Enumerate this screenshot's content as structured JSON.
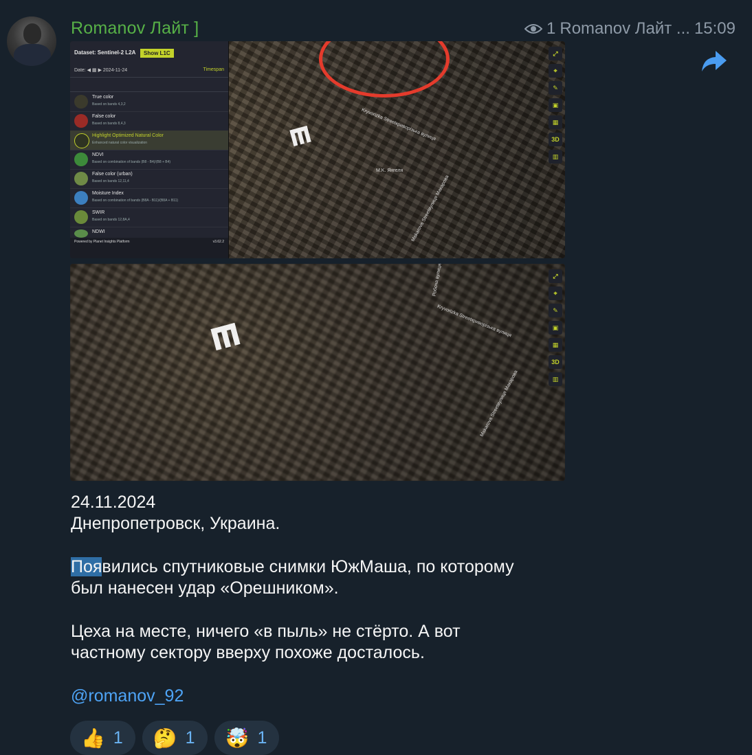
{
  "message": {
    "sender": "Romanov Лайт ]",
    "views": "1",
    "views_author": "Romanov Лайт ...",
    "time": "15:09",
    "text": {
      "date": "24.11.2024",
      "location": "Днепропетровск, Украина.",
      "p2_highlight": "Поя",
      "p2_rest_line1": "вились спутниковые снимки ЮжМаша, по которому",
      "p2_line2": "был нанесен удар «Орешником».",
      "p3_line1": "Цеха на месте, ничего «в пыль» не стёрто. А вот",
      "p3_line2": "частному сектору вверху похоже досталось.",
      "link": "@romanov_92"
    },
    "reactions": [
      {
        "emoji": "👍",
        "count": "1"
      },
      {
        "emoji": "🤔",
        "count": "1"
      },
      {
        "emoji": "🤯",
        "count": "1"
      }
    ]
  },
  "screenshot1": {
    "dataset": "Dataset: Sentinel-2 L2A",
    "show_l1c": "Show L1C",
    "date": "Date: ◀ ▦ ▶ 2024-11-24",
    "timespan": "Timespan",
    "layers": [
      {
        "name": "True color",
        "desc": "Based on bands 4,3,2",
        "color": "#3b3a2c"
      },
      {
        "name": "False color",
        "desc": "Based on bands 8,4,3",
        "color": "#9a2b26"
      },
      {
        "name": "Highlight Optimized Natural Color",
        "desc": "Enhanced natural color visualization",
        "color": "#2e3322"
      },
      {
        "name": "NDVI",
        "desc": "Based on combination of bands (B8 - B4)/(B8 + B4)",
        "color": "#3d8a3a"
      },
      {
        "name": "False color (urban)",
        "desc": "Based on bands 12,11,4",
        "color": "#6f8a46"
      },
      {
        "name": "Moisture Index",
        "desc": "Based on combination of bands (B8A - B11)/(B8A + B11)",
        "color": "#3c7fbf"
      },
      {
        "name": "SWIR",
        "desc": "Based on bands 12,8A,4",
        "color": "#6a8a3a"
      },
      {
        "name": "NDWI",
        "desc": "",
        "color": "#5a8d4a"
      }
    ],
    "powered": "Powered by Planet Insights Platform",
    "version": "v3.62.2",
    "street1": "Kryvorizka Streetкриворізька вулиця",
    "street2": "Makarova Streetвулиця Макарова",
    "street3": "M.K. Янгеля"
  },
  "screenshot2": {
    "street1": "Kryvorizka Streetкриворізька вулиця",
    "street2": "Makarova Streetвулиця Макарова",
    "street3": "Робоча вулиця"
  },
  "tools": [
    "⤢",
    "⌖",
    "✎",
    "▣",
    "▦",
    "3D",
    "▥"
  ]
}
